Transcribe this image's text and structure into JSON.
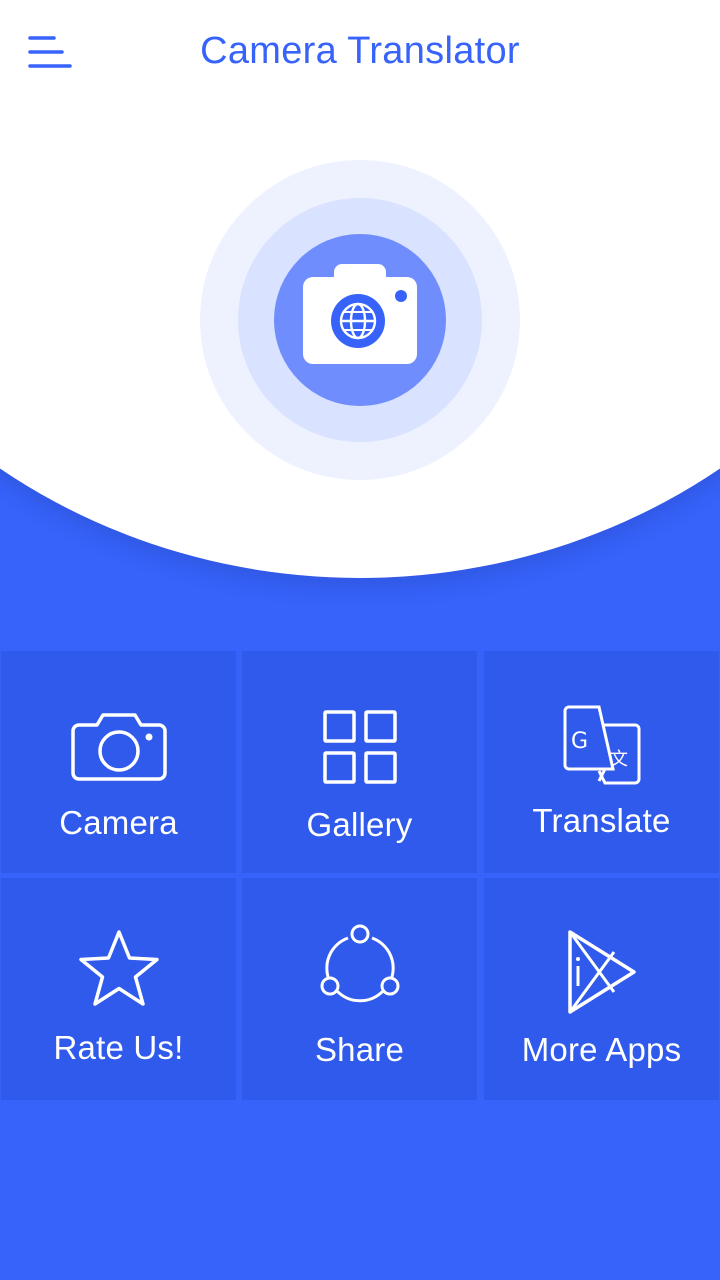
{
  "header": {
    "title": "Camera Translator",
    "menu_icon": "menu-icon"
  },
  "hero": {
    "logo_icon": "camera-globe-icon"
  },
  "colors": {
    "primary": "#3763fb",
    "tile": "#2f5aeb",
    "ring_outer": "#eef2ff",
    "ring_middle": "#d9e3ff",
    "ring_inner": "#6f8dfd",
    "white": "#ffffff"
  },
  "grid": {
    "items": [
      {
        "label": "Camera",
        "icon": "camera-icon"
      },
      {
        "label": "Gallery",
        "icon": "grid-icon"
      },
      {
        "label": "Translate",
        "icon": "translate-icon"
      },
      {
        "label": "Rate Us!",
        "icon": "star-icon"
      },
      {
        "label": "Share",
        "icon": "share-icon"
      },
      {
        "label": "More Apps",
        "icon": "play-store-icon"
      }
    ]
  }
}
